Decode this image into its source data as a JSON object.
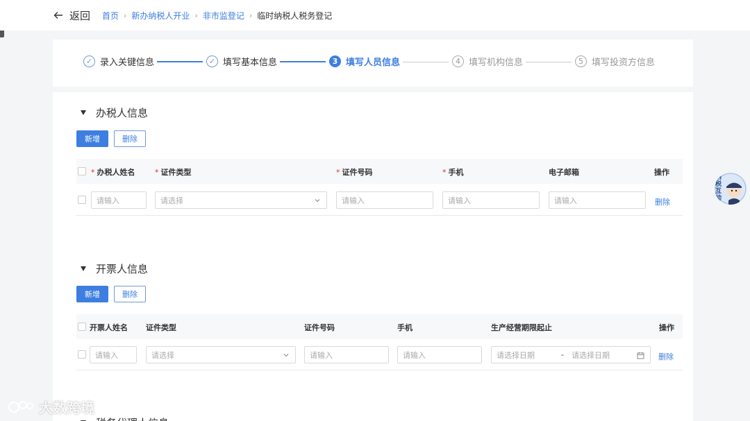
{
  "header": {
    "back_label": "返回",
    "breadcrumbs": [
      "首页",
      "新办纳税人开业",
      "非市监登记",
      "临时纳税人税务登记"
    ]
  },
  "steps": [
    {
      "num": "",
      "label": "录入关键信息",
      "state": "done"
    },
    {
      "num": "",
      "label": "填写基本信息",
      "state": "done"
    },
    {
      "num": "3",
      "label": "填写人员信息",
      "state": "active"
    },
    {
      "num": "4",
      "label": "填写机构信息",
      "state": "todo"
    },
    {
      "num": "5",
      "label": "填写投资方信息",
      "state": "todo"
    }
  ],
  "tax_handler": {
    "title": "办税人信息",
    "add_label": "新增",
    "delete_label": "删除",
    "columns": [
      "办税人姓名",
      "证件类型",
      "证件号码",
      "手机",
      "电子邮箱",
      "操作"
    ],
    "required": [
      true,
      true,
      true,
      true,
      false,
      false
    ],
    "row": {
      "name_placeholder": "请输入",
      "idtype_placeholder": "请选择",
      "idno_placeholder": "请输入",
      "phone_placeholder": "请输入",
      "email_placeholder": "请输入",
      "delete_label": "删除"
    }
  },
  "invoicer": {
    "title": "开票人信息",
    "add_label": "新增",
    "delete_label": "删除",
    "columns": [
      "开票人姓名",
      "证件类型",
      "证件号码",
      "手机",
      "生产经营期限起止",
      "操作"
    ],
    "row": {
      "name_placeholder": "请输入",
      "idtype_placeholder": "请选择",
      "idno_placeholder": "请输入",
      "phone_placeholder": "请输入",
      "start_date_placeholder": "请选择日期",
      "range_sep": "-",
      "end_date_placeholder": "请选择日期",
      "delete_label": "删除"
    }
  },
  "next_section_title": "税务代理人信息",
  "float_widget": {
    "text": "纳税互动"
  },
  "watermark": "大数跨境",
  "colors": {
    "accent": "#3d7ee0",
    "required": "#e02e2e"
  }
}
